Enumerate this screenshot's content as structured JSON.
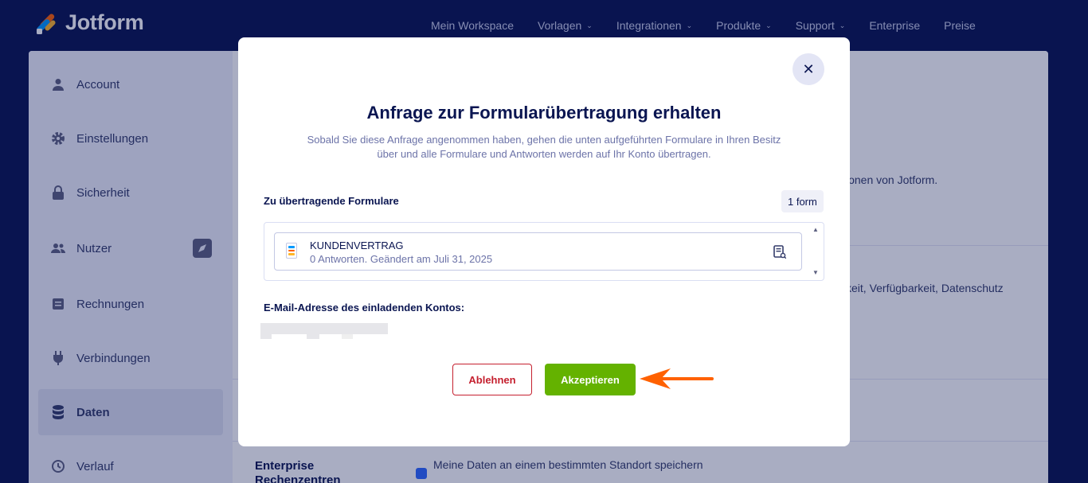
{
  "header": {
    "brand": "Jotform",
    "nav": [
      {
        "label": "Mein Workspace",
        "dropdown": false
      },
      {
        "label": "Vorlagen",
        "dropdown": true
      },
      {
        "label": "Integrationen",
        "dropdown": true
      },
      {
        "label": "Produkte",
        "dropdown": true
      },
      {
        "label": "Support",
        "dropdown": true
      },
      {
        "label": "Enterprise",
        "dropdown": false
      },
      {
        "label": "Preise",
        "dropdown": false
      }
    ]
  },
  "sidebar": {
    "items": [
      {
        "label": "Account",
        "icon": "user-icon"
      },
      {
        "label": "Einstellungen",
        "icon": "gear-icon"
      },
      {
        "label": "Sicherheit",
        "icon": "lock-icon"
      },
      {
        "label": "Nutzer",
        "icon": "users-icon"
      },
      {
        "label": "Rechnungen",
        "icon": "invoice-icon"
      },
      {
        "label": "Verbindungen",
        "icon": "plug-icon"
      },
      {
        "label": "Daten",
        "icon": "database-icon",
        "active": true
      },
      {
        "label": "Verlauf",
        "icon": "history-icon"
      }
    ]
  },
  "content": {
    "snippet_1": "ionen von Jotform.",
    "snippet_2": "keit, Verfügbarkeit, Datenschutz",
    "enterprise_label": "Enterprise Rechenzentren",
    "checkbox_label": "Meine Daten an einem bestimmten Standort speichern"
  },
  "modal": {
    "close_symbol": "✕",
    "title": "Anfrage zur Formularübertragung erhalten",
    "description": "Sobald Sie diese Anfrage angenommen haben, gehen die unten aufgeführten Formulare in Ihren Besitz über und alle Formulare und Antworten werden auf Ihr Konto übertragen.",
    "forms_label": "Zu übertragende Formulare",
    "forms_count": "1 form",
    "forms": [
      {
        "name": "KUNDENVERTRAG",
        "meta": "0 Antworten. Geändert am Juli 31, 2025"
      }
    ],
    "email_label": "E-Mail-Adresse des einladenden Kontos:",
    "decline_label": "Ablehnen",
    "accept_label": "Akzeptieren"
  },
  "colors": {
    "navy": "#0a1551",
    "accept_green": "#64b200",
    "decline_red": "#c5202f",
    "annotation_arrow": "#ff6100"
  }
}
